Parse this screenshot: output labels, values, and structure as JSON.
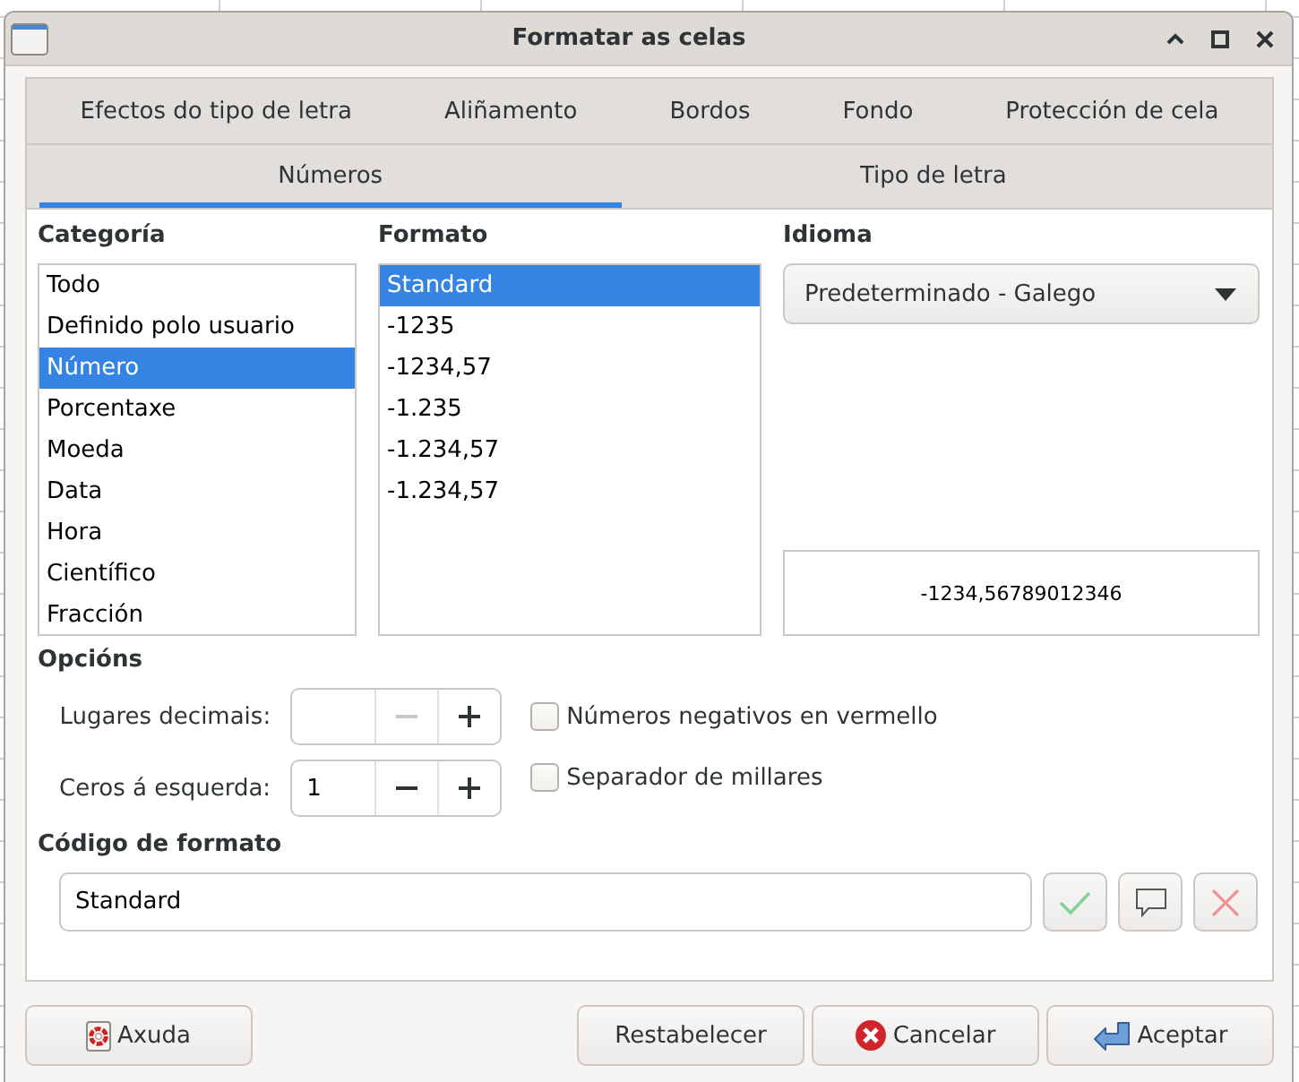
{
  "window": {
    "title": "Formatar as celas"
  },
  "tab_rows": [
    {
      "tabs": [
        {
          "label": "Efectos do tipo de letra",
          "selected": false
        },
        {
          "label": "Aliñamento",
          "selected": false
        },
        {
          "label": "Bordos",
          "selected": false
        },
        {
          "label": "Fondo",
          "selected": false
        },
        {
          "label": "Protección de cela",
          "selected": false
        }
      ]
    },
    {
      "tabs": [
        {
          "label": "Números",
          "selected": true
        },
        {
          "label": "Tipo de letra",
          "selected": false
        }
      ]
    }
  ],
  "category": {
    "label": "Categoría",
    "items": [
      {
        "label": "Todo",
        "selected": false
      },
      {
        "label": "Definido polo usuario",
        "selected": false
      },
      {
        "label": "Número",
        "selected": true
      },
      {
        "label": "Porcentaxe",
        "selected": false
      },
      {
        "label": "Moeda",
        "selected": false
      },
      {
        "label": "Data",
        "selected": false
      },
      {
        "label": "Hora",
        "selected": false
      },
      {
        "label": "Científico",
        "selected": false
      },
      {
        "label": "Fracción",
        "selected": false
      }
    ]
  },
  "format": {
    "label": "Formato",
    "items": [
      {
        "label": "Standard",
        "selected": true
      },
      {
        "label": "-1235",
        "selected": false
      },
      {
        "label": "-1234,57",
        "selected": false
      },
      {
        "label": "-1.235",
        "selected": false
      },
      {
        "label": "-1.234,57",
        "selected": false
      },
      {
        "label": "-1.234,57",
        "selected": false
      }
    ]
  },
  "language": {
    "label": "Idioma",
    "value": "Predeterminado - Galego"
  },
  "preview": {
    "text": "-1234,56789012346"
  },
  "options": {
    "label": "Opcións",
    "spinners": [
      {
        "label": "Lugares decimais:",
        "minus_disabled": true
      },
      {
        "label": "Ceros á esquerda:",
        "value": "1",
        "minus_disabled": false
      }
    ],
    "checkboxes": [
      {
        "label": "Números negativos en vermello",
        "checked": false
      },
      {
        "label": "Separador de millares",
        "checked": false
      }
    ]
  },
  "format_code": {
    "label": "Código de formato",
    "value": "Standard",
    "buttons": [
      {
        "kind": "add",
        "disabled": true
      },
      {
        "kind": "comment",
        "disabled": false
      },
      {
        "kind": "delete",
        "disabled": true
      }
    ]
  },
  "buttons": [
    {
      "label": "Axuda",
      "kind": "help"
    },
    {
      "label": "Restabelecer",
      "kind": "reset"
    },
    {
      "label": "Cancelar",
      "kind": "cancel"
    },
    {
      "label": "Aceptar",
      "kind": "ok"
    }
  ]
}
